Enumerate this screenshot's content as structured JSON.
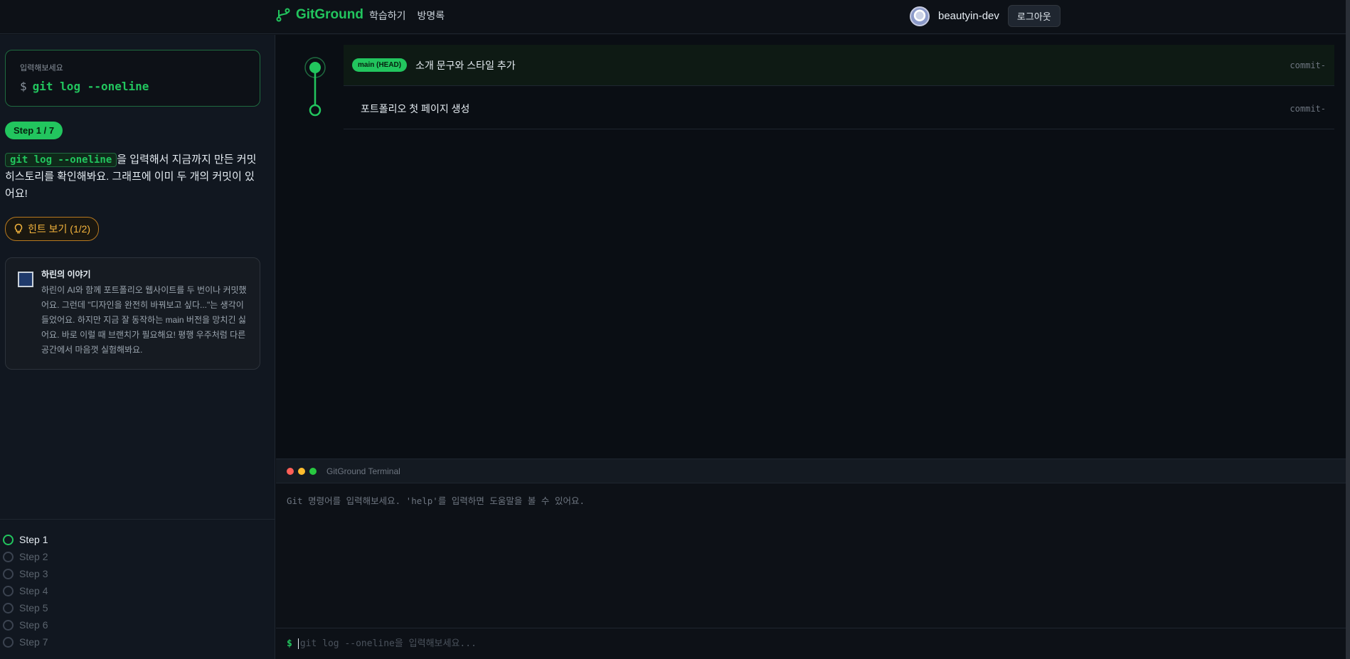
{
  "header": {
    "logo": "GitGround",
    "nav": [
      "학습하기",
      "방명록"
    ],
    "username": "beautyin-dev",
    "logout": "로그아웃"
  },
  "sidebar": {
    "cmd_label": "입력해보세요",
    "cmd_prompt": "$",
    "cmd": "git log --oneline",
    "step_badge": "Step 1 / 7",
    "desc_code": "git log --oneline",
    "desc_text": "을 입력해서 지금까지 만든 커밋 히스토리를 확인해봐요. 그래프에 이미 두 개의 커밋이 있어요!",
    "hint": "힌트 보기 (1/2)",
    "story_title": "하린의 이야기",
    "story_text": "하린이 AI와 함께 포트폴리오 웹사이트를 두 번이나 커밋했어요. 그런데 \"디자인을 완전히 바꿔보고 싶다...\"는 생각이 들었어요. 하지만 지금 잘 동작하는 main 버전을 망치긴 싫어요. 바로 이럴 때 브랜치가 필요해요! 평행 우주처럼 다른 공간에서 마음껏 실험해봐요.",
    "steps": [
      "Step 1",
      "Step 2",
      "Step 3",
      "Step 4",
      "Step 5",
      "Step 6",
      "Step 7"
    ]
  },
  "graph": {
    "commits": [
      {
        "branch": "main (HEAD)",
        "message": "소개 문구와 스타일 추가",
        "hash": "commit-"
      },
      {
        "message": "포트폴리오 첫 페이지 생성",
        "hash": "commit-"
      }
    ]
  },
  "terminal": {
    "title": "GitGround Terminal",
    "help": "Git 명령어를 입력해보세요. 'help'를 입력하면 도움말을 볼 수 있어요.",
    "prompt": "$",
    "placeholder": "git log --oneline을 입력해보세요..."
  },
  "colors": {
    "accent": "#22c55e",
    "hint": "#f5b53d",
    "bg": "#0d1117"
  }
}
